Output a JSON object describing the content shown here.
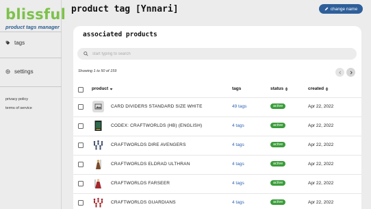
{
  "sidebar": {
    "logo": "blissful",
    "logo_subtitle": "product tags manager",
    "items": [
      {
        "label": "tags",
        "icon": "tag-icon"
      },
      {
        "label": "settings",
        "icon": "gear-icon"
      }
    ],
    "links": [
      "privacy policy",
      "terms of service"
    ]
  },
  "header": {
    "title": "product tag [Ynnari]",
    "change_name_label": "change name"
  },
  "card": {
    "title": "associated products",
    "search_placeholder": "start typing to search",
    "showing": "Showing 1 to 50 of 159",
    "columns": {
      "product": "product",
      "tags": "tags",
      "status": "status",
      "created": "created"
    },
    "rows": [
      {
        "name": "CARD DIVIDERS STANDARD SIZE WHITE",
        "tags": "49 tags",
        "status": "active",
        "created": "Apr 22, 2022",
        "thumb": "placeholder-image"
      },
      {
        "name": "CODEX: CRAFTWORLDS (HB) (ENGLISH)",
        "tags": "4 tags",
        "status": "active",
        "created": "Apr 22, 2022",
        "thumb": "book-cover"
      },
      {
        "name": "CRAFTWORLDS DIRE AVENGERS",
        "tags": "4 tags",
        "status": "active",
        "created": "Apr 22, 2022",
        "thumb": "miniatures-group"
      },
      {
        "name": "CRAFTWORLDS ELDRAD ULTHRAN",
        "tags": "4 tags",
        "status": "active",
        "created": "Apr 22, 2022",
        "thumb": "miniature-single"
      },
      {
        "name": "CRAFTWORLDS FARSEER",
        "tags": "4 tags",
        "status": "active",
        "created": "Apr 22, 2022",
        "thumb": "miniature-single-red"
      },
      {
        "name": "CRAFTWORLDS GUARDIANS",
        "tags": "4 tags",
        "status": "active",
        "created": "Apr 22, 2022",
        "thumb": "miniatures-group-red"
      }
    ]
  },
  "colors": {
    "accent": "#2e5f9a",
    "logo": "#7cc24a",
    "active": "#3a9d3a",
    "link": "#2e63b5"
  }
}
